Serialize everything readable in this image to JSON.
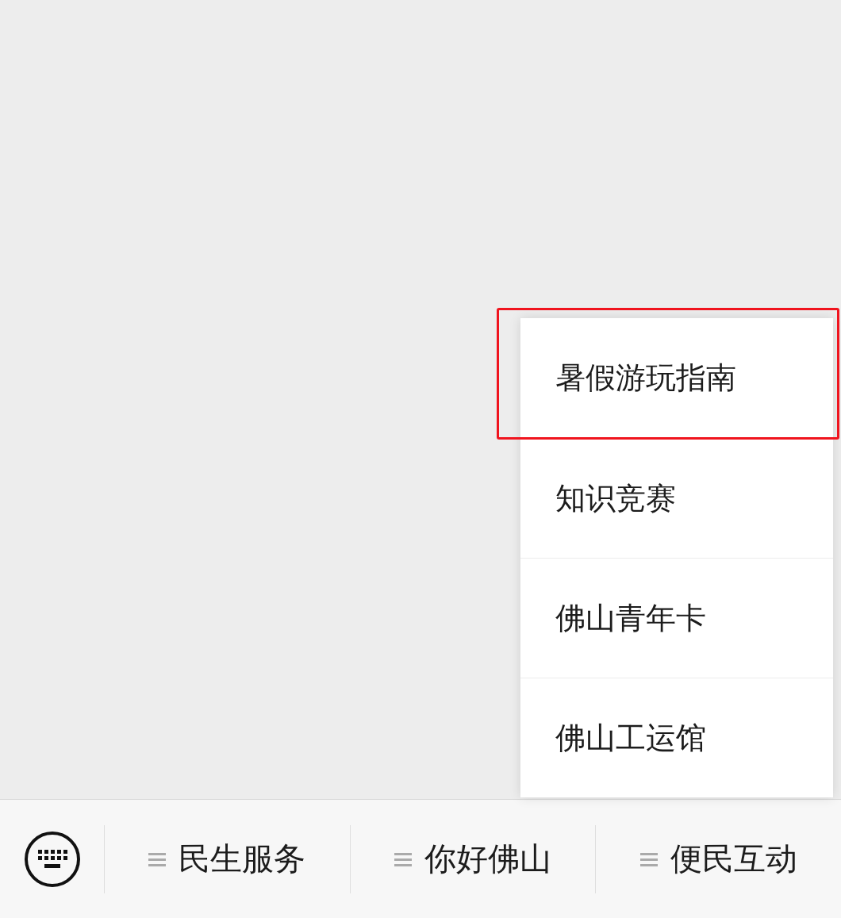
{
  "submenu": {
    "items": [
      {
        "label": "暑假游玩指南",
        "highlighted": true
      },
      {
        "label": "知识竞赛",
        "highlighted": false
      },
      {
        "label": "佛山青年卡",
        "highlighted": false
      },
      {
        "label": "佛山工运馆",
        "highlighted": false
      }
    ]
  },
  "menu_bar": {
    "items": [
      {
        "label": "民生服务"
      },
      {
        "label": "你好佛山"
      },
      {
        "label": "便民互动"
      }
    ]
  }
}
